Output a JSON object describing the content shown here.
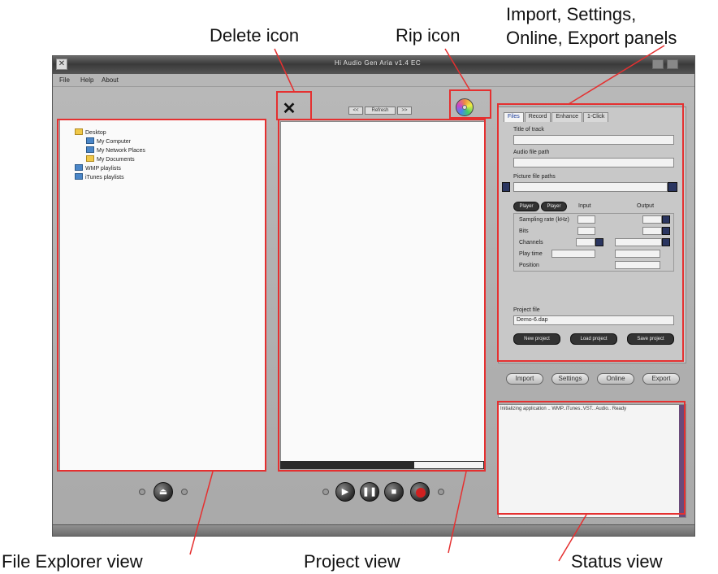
{
  "callouts": {
    "delete_icon": "Delete icon",
    "rip_icon": "Rip icon",
    "panels_line1": "Import, Settings,",
    "panels_line2": "Online, Export panels",
    "file_explorer": "File Explorer view",
    "project_view": "Project view",
    "status_view": "Status view"
  },
  "window": {
    "title": "Hi Audio Gen Aria v1.4 EC",
    "menu": [
      "File",
      "Help",
      "About"
    ]
  },
  "file_tree": [
    {
      "label": "Desktop",
      "level": 0,
      "icon": "folder-icon"
    },
    {
      "label": "My Computer",
      "level": 1,
      "icon": "computer-icon"
    },
    {
      "label": "My Network Places",
      "level": 1,
      "icon": "network-icon"
    },
    {
      "label": "My Documents",
      "level": 1,
      "icon": "documents-icon"
    },
    {
      "label": "WMP playlists",
      "level": 0,
      "icon": "playlist-icon"
    },
    {
      "label": "iTunes playlists",
      "level": 0,
      "icon": "playlist-icon"
    }
  ],
  "project": {
    "nav_buttons": [
      "<<",
      "Refresh",
      ">>"
    ]
  },
  "panel": {
    "tabs": [
      "Files",
      "Record",
      "Enhance",
      "1-Click"
    ],
    "title_label": "Title of track",
    "audio_path_label": "Audio file path",
    "picture_path_label": "Picture file paths",
    "pills": [
      "Player",
      "Player"
    ],
    "input_header": "Input",
    "output_header": "Output",
    "rows": [
      "Sampling rate (kHz)",
      "Bits",
      "Channels",
      "Play time",
      "Position"
    ],
    "project_file_label": "Project file",
    "project_file_value": "Demo-6.dap",
    "project_buttons": [
      "New project",
      "Load project",
      "Save project"
    ]
  },
  "panel_switch": [
    "Import",
    "Settings",
    "Online",
    "Export"
  ],
  "status": {
    "text": "Initializing application .. WMP..iTunes..VST.. Audio.. Ready"
  },
  "colors": {
    "callout_red": "#e53030",
    "window_grey": "#b0b0b0",
    "record_red": "#d02020"
  }
}
